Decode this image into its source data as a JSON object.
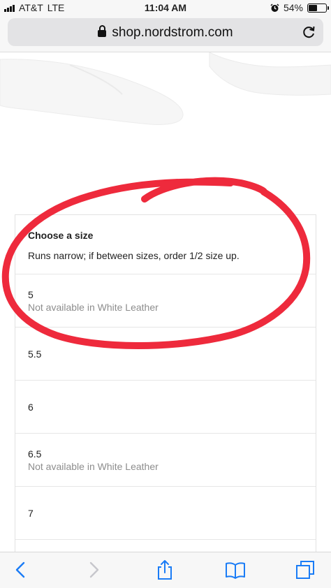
{
  "status_bar": {
    "carrier": "AT&T",
    "network": "LTE",
    "time": "11:04 AM",
    "battery": "54%",
    "battery_level": 0.54
  },
  "browser": {
    "url": "shop.nordstrom.com"
  },
  "size_picker": {
    "title": "Choose a size",
    "fit_note": "Runs narrow; if between sizes, order 1/2 size up.",
    "sizes": [
      {
        "size": "5",
        "availability": "Not available in White Leather"
      },
      {
        "size": "5.5",
        "availability": ""
      },
      {
        "size": "6",
        "availability": ""
      },
      {
        "size": "6.5",
        "availability": "Not available in White Leather"
      },
      {
        "size": "7",
        "availability": ""
      }
    ]
  },
  "colors": {
    "annotation": "#ee2a3c",
    "ios_blue": "#1a7cf6"
  }
}
